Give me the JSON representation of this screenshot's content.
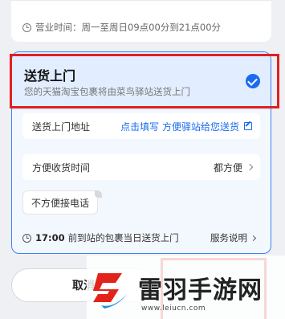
{
  "store": {
    "hours_label": "营业时间：周一至周日09点00分到21点00分"
  },
  "delivery_option": {
    "title": "送货上门",
    "subtitle": "您的天猫淘宝包裹将由菜鸟驿站送货上门",
    "selected": true,
    "address_row": {
      "label": "送货上门地址",
      "value": "点击填写 方便驿站给您送货"
    },
    "time_row": {
      "label": "方便收货时间",
      "value": "都方便"
    },
    "tag": "不方便接电话",
    "service": {
      "time": "17:00",
      "text": "前到站的包裹当日送货上门",
      "link": "服务说明"
    }
  },
  "footer": {
    "cancel_label": "取消"
  },
  "watermark": {
    "title": "雷羽手游网",
    "url": "www.leiucn.com"
  },
  "colors": {
    "accent": "#1a6bf0",
    "highlight": "#e02020",
    "watermark_red": "#e2231a",
    "watermark_blue": "#1a8fe0"
  },
  "icons": [
    "clock-icon",
    "check-circle-icon",
    "edit-icon",
    "chevron-right-icon"
  ]
}
